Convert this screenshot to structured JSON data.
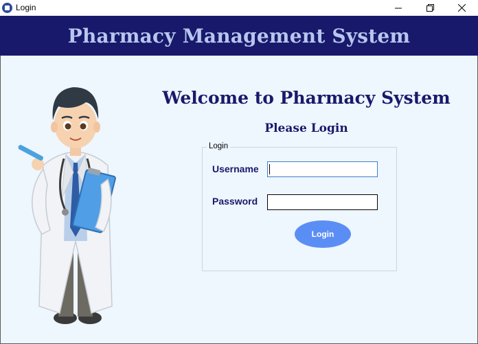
{
  "window": {
    "title": "Login"
  },
  "header": {
    "title": "Pharmacy Management System"
  },
  "main": {
    "welcome": "Welcome to Pharmacy System",
    "subtitle": "Please Login"
  },
  "login_group": {
    "legend": "Login",
    "username_label": "Username",
    "password_label": "Password",
    "username_value": "",
    "password_value": "",
    "button_label": "Login"
  },
  "colors": {
    "header_bg": "#19196b",
    "header_text": "#b8c6ef",
    "content_bg": "#eef6fe",
    "accent_text": "#19196b",
    "button_bg": "#5b8ef5"
  },
  "icons": [
    "app-icon",
    "minimize-icon",
    "maximize-icon",
    "close-icon",
    "doctor-illustration"
  ]
}
